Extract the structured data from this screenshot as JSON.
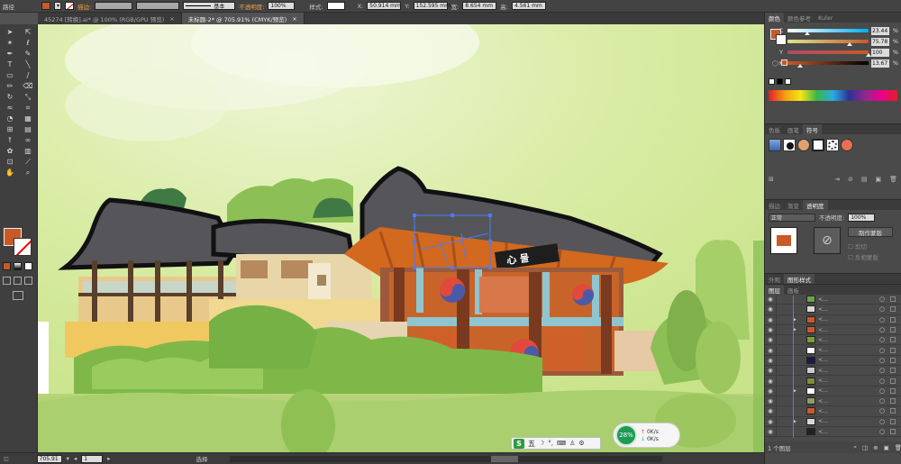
{
  "controlbar": {
    "path_label": "路径",
    "stroke_label": "描边:",
    "stroke_style": "基本",
    "opacity_label": "不透明度:",
    "opacity_value": "100%",
    "style_label": "样式:",
    "x_value": "50.914 mm",
    "y_value": "152.595 mm",
    "w_value": "8.654 mm",
    "h_value": "4.561 mm",
    "fill_color": "#c85a28"
  },
  "tabs": [
    {
      "label": "45274 [转换].ai* @ 100% (RGB/GPU 预览)",
      "close": "×"
    },
    {
      "label": "未标题-2* @ 705.91% (CMYK/预览)",
      "close": "×"
    }
  ],
  "status": {
    "zoom": "705.91",
    "artboard": "1",
    "tool": "选择"
  },
  "ime": {
    "logo": "S",
    "mode": "五",
    "icons": [
      "☽",
      "°,",
      "⌨",
      "♙",
      "⚙"
    ]
  },
  "perf": {
    "percent": "28%",
    "up": "0K/s",
    "down": "0K/s"
  },
  "color_panel": {
    "tabs": [
      "颜色",
      "颜色参考",
      "Kuler"
    ],
    "channels": [
      {
        "name": "C",
        "value": "23.44",
        "pos": 0.23,
        "gradient": "linear-gradient(to right,#fff,#00aeef)"
      },
      {
        "name": "M",
        "value": "75.78",
        "pos": 0.76,
        "gradient": "linear-gradient(to right,#d9e58c,#c85a28)"
      },
      {
        "name": "Y",
        "value": "100",
        "pos": 1.0,
        "gradient": "linear-gradient(to right,#b04a6a,#c85a28)"
      },
      {
        "name": "K",
        "value": "13.67",
        "pos": 0.14,
        "gradient": "linear-gradient(to right,#c85a28,#000)"
      }
    ],
    "unit": "%"
  },
  "swatch_panel": {
    "tabs": [
      "色板",
      "画笔",
      "符号"
    ]
  },
  "transparency_panel": {
    "tabs": [
      "描边",
      "渐变",
      "透明度"
    ],
    "blend_mode": "正常",
    "opacity_label": "不透明度:",
    "opacity_value": "100%",
    "mask_button": "制作蒙版",
    "clip_label": "剪切",
    "invert_label": "反相蒙版"
  },
  "appearance_panel": {
    "tabs": [
      "外观",
      "图形样式"
    ]
  },
  "layers_panel": {
    "tabs": [
      "图层",
      "画板"
    ],
    "footer": "1 个图层",
    "rows": [
      {
        "color": "#6aa34a",
        "arrow": ""
      },
      {
        "color": "#d8d8d8",
        "arrow": ""
      },
      {
        "color": "#c85a28",
        "arrow": "▶"
      },
      {
        "color": "#c85a28",
        "arrow": "▶"
      },
      {
        "color": "#7a9f3a",
        "arrow": ""
      },
      {
        "color": "#ffffff",
        "arrow": ""
      },
      {
        "color": "#1a1a4a",
        "arrow": ""
      },
      {
        "color": "#cccccc",
        "arrow": ""
      },
      {
        "color": "#7a8f3a",
        "arrow": ""
      },
      {
        "color": "#ffffff",
        "arrow": "▶"
      },
      {
        "color": "#8aa060",
        "arrow": ""
      },
      {
        "color": "#c85a28",
        "arrow": ""
      },
      {
        "color": "#d8d8d8",
        "arrow": "▶"
      },
      {
        "color": "#222222",
        "arrow": ""
      }
    ]
  },
  "artwork": {
    "sign_text": "心 물"
  }
}
